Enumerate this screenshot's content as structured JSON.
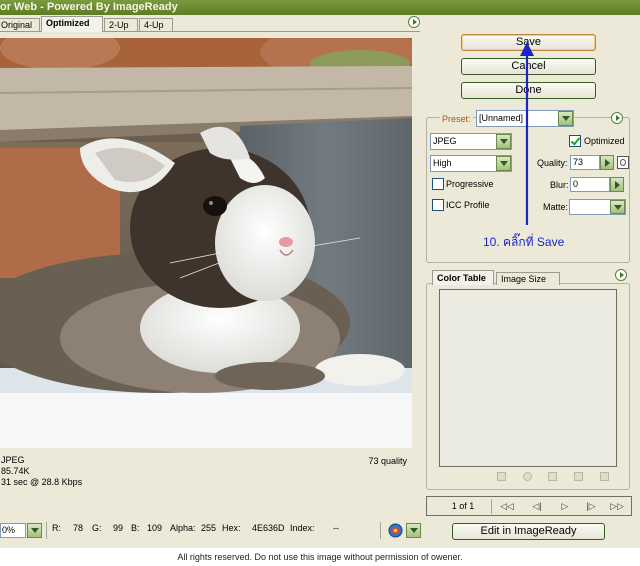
{
  "window": {
    "title": "or Web - Powered By ImageReady"
  },
  "tabs": [
    {
      "label": "Original",
      "active": false
    },
    {
      "label": "Optimized",
      "active": true
    },
    {
      "label": "2-Up",
      "active": false
    },
    {
      "label": "4-Up",
      "active": false
    }
  ],
  "image_info": {
    "format": "JPEG",
    "size": "85.74K",
    "download_time": "31 sec @ 28.8 Kbps",
    "quality": "73 quality"
  },
  "status": {
    "zoom": "0%",
    "r_label": "R:",
    "r_value": "78",
    "g_label": "G:",
    "g_value": "99",
    "b_label": "B:",
    "b_value": "109",
    "alpha_label": "Alpha:",
    "alpha_value": "255",
    "hex_label": "Hex:",
    "hex_value": "4E636D",
    "index_label": "Index:",
    "index_value": "--"
  },
  "buttons": {
    "save": "Save",
    "cancel": "Cancel",
    "done": "Done",
    "edit_in_imageready": "Edit in ImageReady"
  },
  "settings": {
    "preset_label": "Preset:",
    "preset_value": "[Unnamed]",
    "format": "JPEG",
    "optimized_label": "Optimized",
    "optimized_checked": true,
    "quality_preset": "High",
    "quality_label": "Quality:",
    "quality_value": "73",
    "progressive_label": "Progressive",
    "progressive_checked": false,
    "blur_label": "Blur:",
    "blur_value": "0",
    "icc_label": "ICC Profile",
    "icc_checked": false,
    "matte_label": "Matte:",
    "matte_value": ""
  },
  "bottom_tabs": [
    {
      "label": "Color Table",
      "active": true
    },
    {
      "label": "Image Size",
      "active": false
    }
  ],
  "animation": {
    "frame_counter": "1 of 1",
    "first": "◁◁",
    "prev": "◁|",
    "play": "▷",
    "next": "|▷",
    "last": "▷▷"
  },
  "annotation": {
    "text": "10. คลิ๊กที่ Save",
    "color": "#1a24c8"
  },
  "footer": {
    "text": "All rights reserved. Do not use this image without permission of owener."
  },
  "colors": {
    "titlebar": "#6b8c30",
    "panel": "#ece9d8",
    "accent_green": "#3f7a1e",
    "preset_orange": "#b3541e"
  }
}
